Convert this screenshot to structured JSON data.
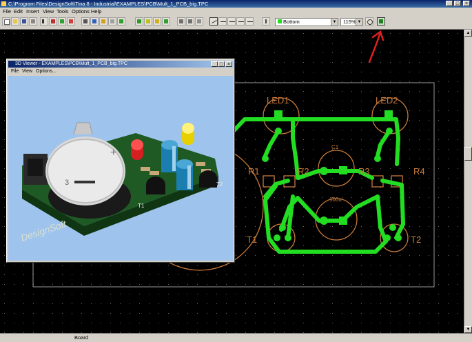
{
  "window": {
    "title": "C:\\Program Files\\DesignSoft\\Tina 8 - Industrial\\EXAMPLES\\PCB\\Mult_1_PCB_big.TPC",
    "controls": [
      "_",
      "□",
      "×"
    ]
  },
  "menu": [
    "File",
    "Edit",
    "Insert",
    "View",
    "Tools",
    "Options",
    "Help"
  ],
  "toolbar": {
    "layer_select": "Bottom",
    "zoom_select": "115%",
    "icons": [
      "new-icon",
      "open-icon",
      "save-icon",
      "print-icon",
      "select-icon",
      "pan-icon",
      "place-icon",
      "rotate-icon",
      "wire-icon",
      "text-icon",
      "component-icon",
      "pad-icon",
      "via-icon",
      "polygon-icon",
      "outline-icon",
      "measure-icon",
      "undo-icon",
      "redo-icon",
      "track-icon",
      "arc-icon",
      "line-icon",
      "curve-icon",
      "drc-icon",
      "zoom-in-icon",
      "3d-view-icon"
    ]
  },
  "viewer": {
    "title": "3D Viewer - EXAMPLES\\PCB\\Mult_1_PCB_big.TPC",
    "menu": [
      "File",
      "View",
      "Options..."
    ],
    "board_brand": "DesignSoft",
    "silkscreen": [
      "T1",
      "T2",
      "+",
      "3"
    ]
  },
  "pcb": {
    "labels": {
      "led1": "LED1",
      "led2": "LED2",
      "r1": "R1",
      "r2": "R2",
      "r3": "R3",
      "r4": "R4",
      "c1": "C1",
      "c2": "100u",
      "t1": "T1",
      "t2": "T2"
    },
    "colors": {
      "track": "#22dd22",
      "silk": "#c87a3a",
      "background": "#000000",
      "grid": "#6a6a6a"
    }
  },
  "annotation": {
    "color": "#e02020"
  },
  "status": {
    "layer": "Board"
  }
}
